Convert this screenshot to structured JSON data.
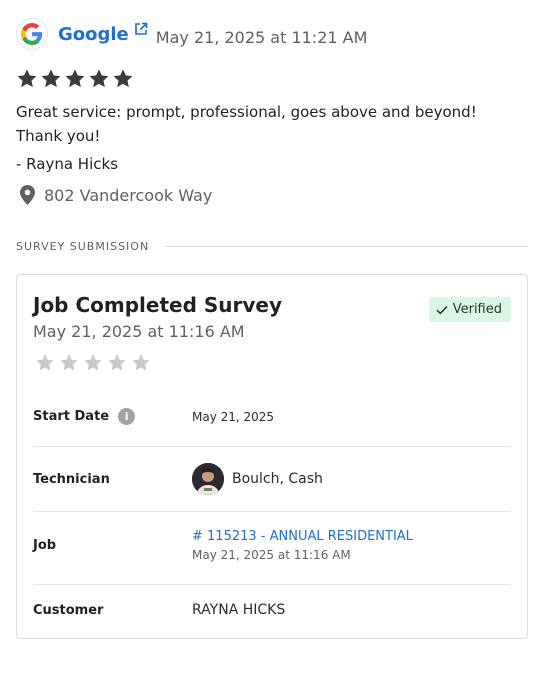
{
  "review": {
    "source": "Google",
    "date": "May 21, 2025 at 11:21 AM",
    "rating": 5,
    "text_lines": [
      "Great service: prompt, professional, goes above and beyond!",
      "Thank you!"
    ],
    "author": "- Rayna Hicks",
    "location": "802 Vandercook Way"
  },
  "section_label": "SURVEY SUBMISSION",
  "survey": {
    "title": "Job Completed Survey",
    "date": "May 21, 2025 at 11:16 AM",
    "badge": "Verified",
    "rating": 0,
    "rows": {
      "start_date": {
        "label": "Start Date",
        "value": "May 21, 2025"
      },
      "technician": {
        "label": "Technician",
        "value": "Boulch, Cash"
      },
      "job": {
        "label": "Job",
        "value": "# 115213 - ANNUAL RESIDENTIAL",
        "sub": "May 21, 2025 at 11:16 AM"
      },
      "customer": {
        "label": "Customer",
        "value": "RAYNA HICKS"
      }
    }
  },
  "colors": {
    "link": "#1f6fd1",
    "star_filled": "#3a3c40",
    "star_empty": "#c7c9cc",
    "badge_bg": "#dcf5e4"
  }
}
